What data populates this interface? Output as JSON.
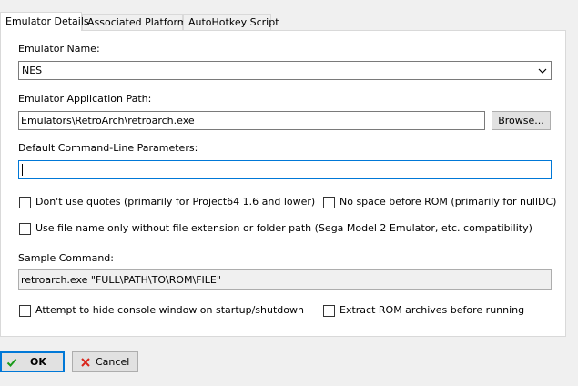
{
  "tabs": [
    {
      "label": "Emulator Details",
      "active": true
    },
    {
      "label": "Associated Platforms",
      "active": false
    },
    {
      "label": "AutoHotkey Script",
      "active": false
    }
  ],
  "form": {
    "emulator_name_label": "Emulator Name:",
    "emulator_name_value": "NES",
    "app_path_label": "Emulator Application Path:",
    "app_path_value": "Emulators\\RetroArch\\retroarch.exe",
    "browse_label": "Browse...",
    "cmdline_label": "Default Command-Line Parameters:",
    "cmdline_value": "",
    "no_quotes_label": "Don't use quotes (primarily for Project64 1.6 and lower)",
    "no_space_label": "No space before ROM (primarily for nullDC)",
    "file_name_only_label": "Use file name only without file extension or folder path (Sega Model 2 Emulator, etc. compatibility)",
    "sample_command_label": "Sample Command:",
    "sample_command_value": "retroarch.exe \"FULL\\PATH\\TO\\ROM\\FILE\"",
    "hide_console_label": "Attempt to hide console window on startup/shutdown",
    "extract_rom_label": "Extract ROM archives before running"
  },
  "checkboxes": {
    "no_quotes": false,
    "no_space": false,
    "file_name_only": false,
    "hide_console": false,
    "extract_rom": false
  },
  "buttons": {
    "ok_label": "OK",
    "cancel_label": "Cancel"
  },
  "colors": {
    "focus_border": "#0078d7",
    "ok_icon": "#1a9b1a",
    "cancel_icon": "#d9261c"
  }
}
